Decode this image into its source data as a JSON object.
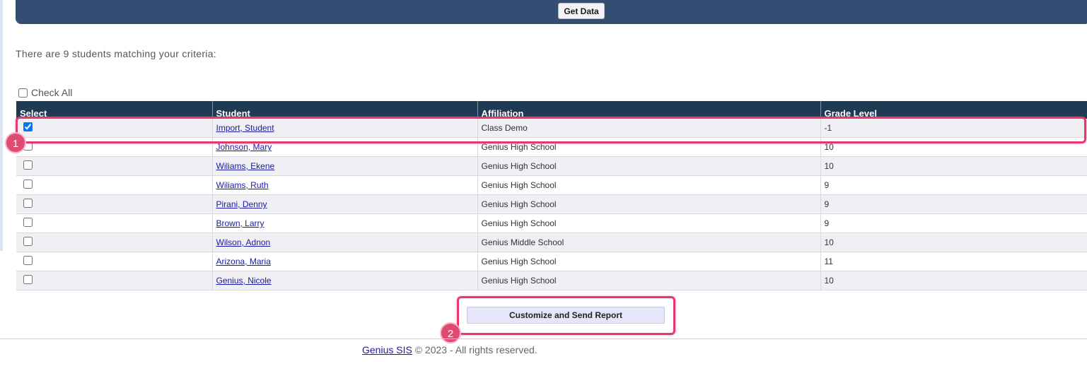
{
  "toolbar": {
    "get_data_label": "Get Data"
  },
  "results": {
    "count_text": "There are 9 students matching your criteria:"
  },
  "check_all_label": "Check All",
  "table": {
    "headers": [
      "Select",
      "Student",
      "Affiliation",
      "Grade Level"
    ],
    "rows": [
      {
        "checked": true,
        "student": "Import, Student",
        "affiliation": "Class Demo",
        "grade": "-1"
      },
      {
        "checked": false,
        "student": "Johnson, Mary",
        "affiliation": "Genius High School",
        "grade": "10"
      },
      {
        "checked": false,
        "student": "Wiliams, Ekene",
        "affiliation": "Genius High School",
        "grade": "10"
      },
      {
        "checked": false,
        "student": "Wiliams, Ruth",
        "affiliation": "Genius High School",
        "grade": "9"
      },
      {
        "checked": false,
        "student": "Pirani, Denny",
        "affiliation": "Genius High School",
        "grade": "9"
      },
      {
        "checked": false,
        "student": "Brown, Larry",
        "affiliation": "Genius High School",
        "grade": "9"
      },
      {
        "checked": false,
        "student": "Wilson, Adnon",
        "affiliation": "Genius Middle School",
        "grade": "10"
      },
      {
        "checked": false,
        "student": "Arizona, Maria",
        "affiliation": "Genius High School",
        "grade": "11"
      },
      {
        "checked": false,
        "student": "Genius, Nicole",
        "affiliation": "Genius High School",
        "grade": "10"
      }
    ]
  },
  "actions": {
    "send_report_label": "Customize and Send Report"
  },
  "annotations": {
    "badge_1": "1",
    "badge_2": "2"
  },
  "footer": {
    "link_text": "Genius SIS",
    "text": " © 2023 - All rights reserved."
  },
  "colors": {
    "header_bar": "#334d73",
    "table_header": "#1f3a54",
    "highlight": "#e8386b",
    "link": "#1a1aa6"
  }
}
